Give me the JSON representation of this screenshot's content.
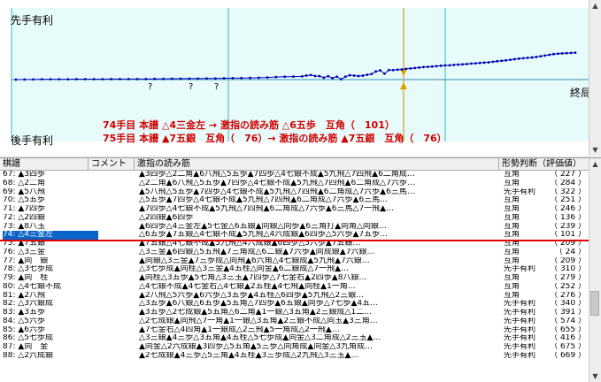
{
  "graph": {
    "top_label": "先手有利",
    "bottom_label": "後手有利",
    "end_label": "終局",
    "question_marks": [
      "?",
      "?",
      "?"
    ],
    "info_line1": "74手目 本譜 △4三金左 → 激指の読み筋 △6五歩　互角（　101）",
    "info_line2": "75手目 本譜 ▲7五銀　互角（　76）→ 激指の読み筋 ▲7五銀　互角（　76）",
    "scroll_up": "▲",
    "scroll_down": "▼"
  },
  "table": {
    "headers": {
      "move": "棋譜",
      "comment": "コメント",
      "pv": "激指の読み筋",
      "judge": "形勢判断（評価値）"
    },
    "rows": [
      {
        "move": "67: ▲3四歩",
        "pv": "▲3四歩△2二角▲6八飛△5五歩▲7四歩△4七銀不成▲5九飛△7四飛▲6二角成…",
        "judge": "互角",
        "score": "227"
      },
      {
        "move": "68: △2二角",
        "pv": "△2二角▲6八飛△5五歩▲7四歩△4七銀不成▲5九飛△7四飛▲6二角成△7六歩…",
        "judge": "互角",
        "score": "284"
      },
      {
        "move": "69: ▲5八飛",
        "pv": "▲5八飛△5五歩▲7四歩△4七銀不成▲5九飛△7四飛▲6二角成△7六歩▲6三馬…",
        "judge": "先手有利",
        "score": "322"
      },
      {
        "move": "70: △5五歩",
        "pv": "△5五歩▲7四歩△4七銀不成▲5九飛△7四飛▲6二角成△7六歩▲6三馬…",
        "judge": "互角",
        "score": "251"
      },
      {
        "move": "71: ▲7四歩",
        "pv": "▲7四歩△4七銀不成▲5九飛△7四飛▲6二角成△7六歩▲6三馬△7一飛▲…",
        "judge": "互角",
        "score": "246"
      },
      {
        "move": "72: △2四銀",
        "pv": "△2四銀▲6四歩",
        "judge": "互角",
        "score": "136"
      },
      {
        "move": "73: ▲8八玉",
        "pv": "▲6四歩△4三金左▲5七金△6五銀▲同銀△同歩▲6三角打▲同角△同銀…",
        "judge": "互角",
        "score": "239"
      },
      {
        "move": "74: △4三金左",
        "pv": "△6五歩▲7五銀△4七銀不成▲5九飛△4六成銀▲6四歩△5六歩▲7五歩…",
        "judge": "互角",
        "score": "101"
      },
      {
        "move": "75: ▲7五銀",
        "pv": "▲7五銀△4七銀不成▲5九飛△4六成銀▲6四歩△5六歩▲7五銀…",
        "judge": "互角",
        "score": "209"
      },
      {
        "move": "76: △3三金",
        "pv": "△3三金▲6四銀△5五飛▲7三角成△6二銀▲7六歩▲同成銀▲7六銀…",
        "judge": "互角",
        "score": "24"
      },
      {
        "move": "77: ▲同　銀",
        "pv": "▲同銀△3三金▲7三歩成△同飛▲6六角△4七銀成▲5九飛▲7六銀…",
        "judge": "互角",
        "score": "209"
      },
      {
        "move": "78: △3七歩成",
        "pv": "△3七歩成▲同桂△3三金▲4五桂△同金▲6二銀成△7一飛▲…",
        "judge": "先手有利",
        "score": "310"
      },
      {
        "move": "79: ▲同　桂",
        "pv": "▲同桂△3五歩▲5七角△3三玉▲7四歩△7七金右▲2四歩▲8八銀…",
        "judge": "互角",
        "score": "279"
      },
      {
        "move": "80: △4七銀不成",
        "pv": "△4七銀不成▲4七金右△4七銀▲2五桂▲4七飛▲同桂▲1一角…",
        "judge": "互角",
        "score": "252"
      },
      {
        "move": "81: ▲2八飛",
        "pv": "▲2八飛△5六歩▲6六歩△3五歩▲4五桂△6四歩▲5九飛△2三銀…",
        "judge": "互角",
        "score": "276"
      },
      {
        "move": "82: △3六銀成",
        "pv": "△3五歩▲6八銀△6五歩▲5五角△7四歩▲6五銀▲同歩△7七歩▲4五…",
        "judge": "先手有利",
        "score": "340"
      },
      {
        "move": "83: ▲3五歩",
        "pv": "▲3五歩△2七成銀▲5五角△6二角▲1一銀△3五角▲2三銀成△1二…",
        "judge": "先手有利",
        "score": "391"
      },
      {
        "move": "84: △5六歩",
        "pv": "△2七成銀▲同飛△7一角▲1一銀△3五角▲2三銀不成△同玉▲3三角…",
        "judge": "先手有利",
        "score": "574"
      },
      {
        "move": "85: ▲6六歩",
        "pv": "▲7七金右△4四角▲1一銀成△2三飛▲5一角成△2一飛▲…",
        "judge": "先手有利",
        "score": "655"
      },
      {
        "move": "86: △5七歩成",
        "pv": "△3三銀▲4三歩△3五角▲4五桂△5七歩成▲同金△3二角成△2三玉▲…",
        "judge": "先手有利",
        "score": "416"
      },
      {
        "move": "87: ▲同　金",
        "pv": "▲同金△2六成銀▲3四歩△5五角▲5三歩△同角成▲同金△3九角成…",
        "judge": "先手有利",
        "score": "675"
      },
      {
        "move": "88: △2六成銀",
        "pv": "▲2七成銀▲4三歩△5三角▲4五桂▲3三歩成△2九飛△3三玉▲…",
        "judge": "先手有利",
        "score": "669"
      }
    ]
  },
  "chart_data": {
    "type": "line",
    "title": "",
    "xlabel": "",
    "ylabel": "",
    "x": [
      1,
      3,
      5,
      7,
      9,
      11,
      13,
      15,
      17,
      19,
      21,
      23,
      25,
      27,
      29,
      31,
      33,
      35,
      37,
      39,
      41,
      43,
      45,
      47,
      49,
      51,
      53,
      55,
      57,
      59,
      61,
      63,
      65,
      67,
      68,
      69,
      70,
      71,
      72,
      73,
      74,
      75,
      76,
      77,
      78,
      79,
      80,
      81,
      82,
      83,
      84,
      85,
      86,
      87,
      88,
      89,
      90,
      91,
      92,
      93,
      94,
      95,
      96,
      97,
      98,
      99,
      100,
      101,
      102,
      103,
      104,
      105,
      106,
      107,
      108,
      109,
      110,
      111,
      112,
      113,
      114,
      115,
      116,
      117,
      118,
      119,
      120,
      121,
      122,
      123,
      124,
      125,
      126,
      127,
      128,
      129,
      130
    ],
    "series": [
      {
        "values": [
          0,
          10,
          10,
          20,
          20,
          20,
          20,
          30,
          30,
          30,
          30,
          40,
          40,
          40,
          40,
          40,
          50,
          50,
          60,
          60,
          70,
          70,
          80,
          80,
          90,
          100,
          110,
          120,
          130,
          150,
          180,
          200,
          210,
          227,
          284,
          322,
          251,
          246,
          136,
          239,
          101,
          209,
          24,
          209,
          310,
          279,
          252,
          276,
          340,
          391,
          574,
          655,
          416,
          675,
          669,
          700,
          720,
          760,
          790,
          820,
          850,
          880,
          900,
          920,
          950,
          980,
          1000,
          1010,
          1040,
          1060,
          1080,
          1100,
          1130,
          1150,
          1180,
          1200,
          1220,
          1260,
          1300,
          1330,
          1360,
          1400,
          1440,
          1480,
          1510,
          1540,
          1560,
          1600,
          1650,
          1700,
          1750,
          1800,
          1830,
          1850,
          1870,
          1880,
          1900
        ]
      }
    ],
    "ylim": [
      -5000,
      5000
    ],
    "grid": true
  }
}
